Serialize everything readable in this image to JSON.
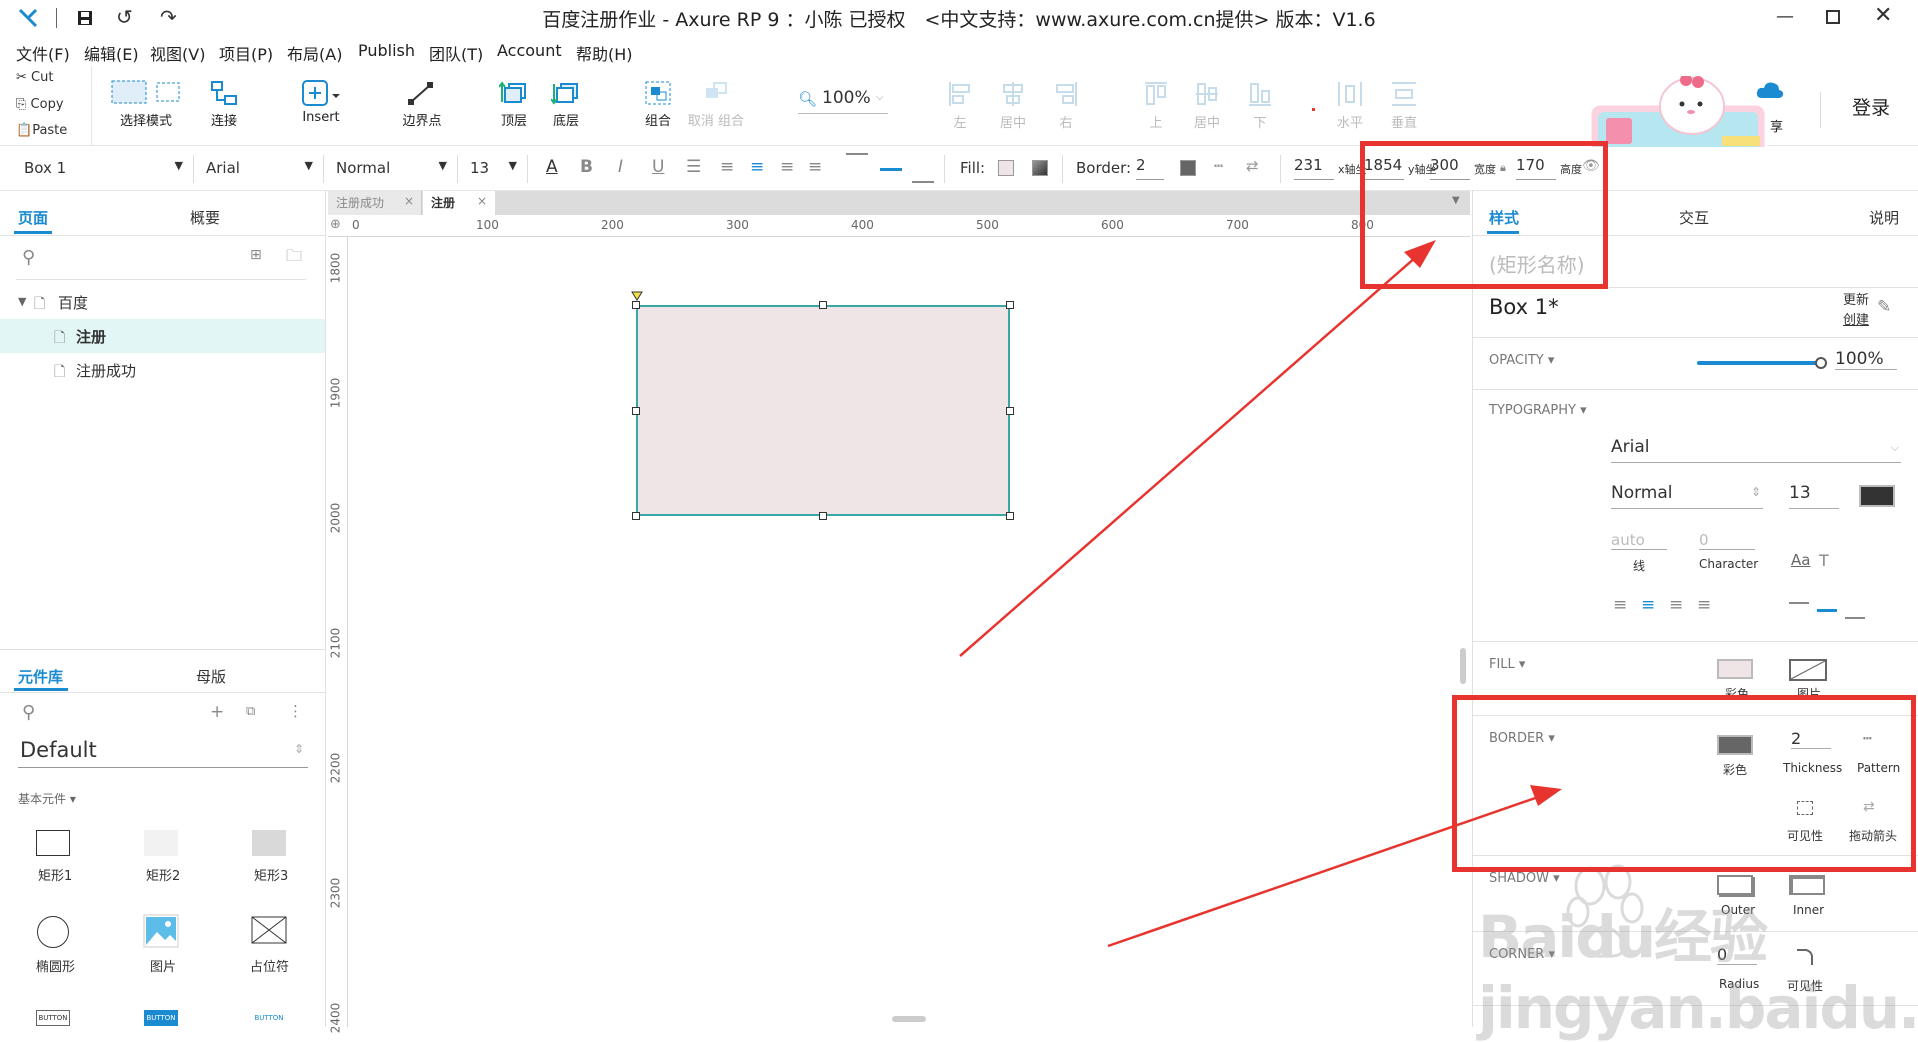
{
  "title_bar": {
    "title": "百度注册作业 - Axure RP 9 ：小陈 已授权　<中文支持：www.axure.com.cn提供> 版本：V1.6"
  },
  "menubar": [
    "文件(F)",
    "编辑(E)",
    "视图(V)",
    "项目(P)",
    "布局(A)",
    "Publish",
    "团队(T)",
    "Account",
    "帮助(H)"
  ],
  "clipboard": {
    "cut": "Cut",
    "copy": "Copy",
    "paste": "Paste"
  },
  "toolbar": {
    "select_mode": "选择模式",
    "connect": "连接",
    "insert": "Insert",
    "points": "边界点",
    "top": "顶层",
    "bottom": "底层",
    "group": "组合",
    "ungroup": "取消 组合",
    "zoom": "100%",
    "align_left": "左",
    "align_center": "居中",
    "align_right": "右",
    "align_top": "上",
    "align_middle": "居中",
    "align_bottom": "下",
    "dist_h": "水平",
    "dist_v": "垂直",
    "share_suffix": "享",
    "login": "登录"
  },
  "format_bar": {
    "widget": "Box 1",
    "font": "Arial",
    "weight": "Normal",
    "size": "13",
    "fill_label": "Fill:",
    "border_label": "Border:",
    "border_value": "2",
    "x": "231",
    "x_label": "x轴坐",
    "y": "1854",
    "y_label": "y轴坐",
    "w": "300",
    "w_label": "宽度",
    "h": "170",
    "h_label": "高度"
  },
  "pages_panel": {
    "tabs": [
      "页面",
      "概要"
    ],
    "root": "百度",
    "pages": [
      "注册",
      "注册成功"
    ]
  },
  "library_panel": {
    "tabs": [
      "元件库",
      "母版"
    ],
    "library": "Default",
    "category": "基本元件 ▾",
    "widgets": [
      "矩形1",
      "矩形2",
      "矩形3",
      "椭圆形",
      "图片",
      "占位符",
      "按钮",
      "主要按钮",
      "链接按钮"
    ],
    "button_texts": [
      "BUTTON",
      "BUTTON",
      "BUTTON"
    ]
  },
  "canvas": {
    "tabs": [
      "注册成功",
      "注册"
    ],
    "hruler": [
      "0",
      "100",
      "200",
      "300",
      "400",
      "500",
      "600",
      "700",
      "800"
    ],
    "vruler": [
      "1800",
      "1900",
      "2000",
      "2100",
      "2200",
      "2300",
      "2400"
    ]
  },
  "right_panel": {
    "tabs": [
      "样式",
      "交互",
      "说明"
    ],
    "name_placeholder": "(矩形名称)",
    "style_name": "Box 1*",
    "update": "更新",
    "create": "创建",
    "opacity_label": "OPACITY ▾",
    "opacity_value": "100%",
    "opacity_level": 1.0,
    "typography_label": "TYPOGRAPHY ▾",
    "font": "Arial",
    "weight": "Normal",
    "size": "13",
    "line_placeholder": "auto",
    "char_placeholder": "0",
    "line_label": "线",
    "char_label": "Character",
    "fill_label": "FILL ▾",
    "fill_color_label": "彩色",
    "fill_image_label": "图片",
    "border_label": "BORDER ▾",
    "border_color_label": "彩色",
    "thickness_value": "2",
    "thickness_label": "Thickness",
    "pattern_label": "Pattern",
    "visibility_label": "可见性",
    "arrow_label": "拖动箭头",
    "shadow_label": "SHADOW ▾",
    "outer_label": "Outer",
    "inner_label": "Inner",
    "corner_label": "CORNER ▾",
    "radius_value": "0",
    "radius_label": "Radius",
    "corner_vis_label": "可见性"
  },
  "watermark": "Baidu经验 jingyan.baidu.com",
  "colors": {
    "accent": "#1a8bd0",
    "selection": "#3aa7a7",
    "box_fill": "#efe5e6",
    "annotation": "#e8342f"
  }
}
